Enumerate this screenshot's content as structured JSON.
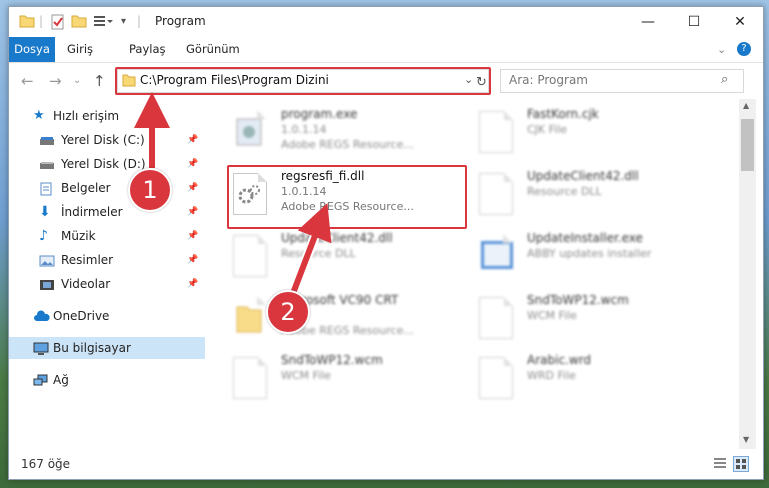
{
  "window": {
    "title": "Program"
  },
  "ribbon": {
    "tabs": [
      "Dosya",
      "Giriş",
      "Paylaş",
      "Görünüm"
    ]
  },
  "address": {
    "path": "C:\\Program Files\\Program Dizini"
  },
  "search": {
    "placeholder": "Ara: Program"
  },
  "sidebar": {
    "items": [
      {
        "label": "Hızlı erişim",
        "icon": "star-icon",
        "pinned": false
      },
      {
        "label": "Yerel Disk (C:)",
        "icon": "drive-icon",
        "pinned": true
      },
      {
        "label": "Yerel Disk (D:)",
        "icon": "drive-icon",
        "pinned": true
      },
      {
        "label": "Belgeler",
        "icon": "documents-icon",
        "pinned": true
      },
      {
        "label": "İndirmeler",
        "icon": "download-icon",
        "pinned": true
      },
      {
        "label": "Müzik",
        "icon": "music-icon",
        "pinned": true
      },
      {
        "label": "Resimler",
        "icon": "pictures-icon",
        "pinned": true
      },
      {
        "label": "Videolar",
        "icon": "videos-icon",
        "pinned": true
      },
      {
        "label": "OneDrive",
        "icon": "cloud-icon",
        "pinned": false
      },
      {
        "label": "Bu bilgisayar",
        "icon": "computer-icon",
        "pinned": false
      },
      {
        "label": "Ağ",
        "icon": "network-icon",
        "pinned": false
      }
    ]
  },
  "files": [
    {
      "name": "program.exe",
      "line2": "1.0.1.14",
      "line3": "Adobe REGS Resource...",
      "icon": "exe-icon"
    },
    {
      "name": "FastKorn.cjk",
      "line2": "CJK File",
      "line3": "",
      "icon": "file-icon"
    },
    {
      "name": "regsresfi_fi.dll",
      "line2": "1.0.1.14",
      "line3": "Adobe REGS Resource...",
      "icon": "dll-gear-icon"
    },
    {
      "name": "UpdateClient42.dll",
      "line2": "Resource DLL",
      "line3": "",
      "icon": "dll-gear-icon"
    },
    {
      "name": "UpdateClient42.dll",
      "line2": "Resource DLL",
      "line3": "",
      "icon": "dll-gear-icon"
    },
    {
      "name": "UpdateInstaller.exe",
      "line2": "ABBY updates installer",
      "line3": "",
      "icon": "installer-icon"
    },
    {
      "name": "Microsoft VC90 CRT",
      "line2": "",
      "line3": "Adobe REGS Resource...",
      "icon": "folder-icon"
    },
    {
      "name": "SndToWP12.wcm",
      "line2": "WCM File",
      "line3": "",
      "icon": "file-icon"
    },
    {
      "name": "SndToWP12.wcm",
      "line2": "WCM File",
      "line3": "",
      "icon": "file-icon"
    },
    {
      "name": "Arabic.wrd",
      "line2": "WRD File",
      "line3": "",
      "icon": "file-icon"
    }
  ],
  "status": {
    "count": "167 öğe"
  },
  "annotations": [
    {
      "number": "1"
    },
    {
      "number": "2"
    }
  ],
  "colors": {
    "accent": "#1979ca",
    "highlight": "#d9363e",
    "selected": "#cce4f7"
  }
}
